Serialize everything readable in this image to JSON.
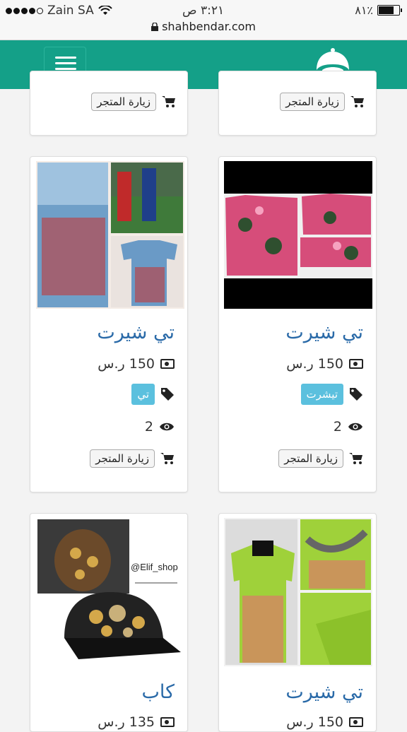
{
  "status_bar": {
    "carrier": "Zain SA",
    "time": "٣:٢١ ص",
    "battery": "٨١٪",
    "battery_level": 0.81,
    "url": "shahbendar.com"
  },
  "colors": {
    "brand": "#14a088",
    "title": "#2a6aa8",
    "badge": "#5bc0de"
  },
  "header": {
    "menu_icon": "hamburger-icon",
    "logo_icon": "turban-logo-icon"
  },
  "cards": [
    {
      "visit_label": "زيارة المتجر"
    },
    {
      "visit_label": "زيارة المتجر"
    },
    {
      "title": "تي شيرت",
      "price": "150 ر.س",
      "tag": "تيشرت",
      "views": "2",
      "visit_label": "زيارة المتجر"
    },
    {
      "title": "تي شيرت",
      "price": "150 ر.س",
      "tag": "تي",
      "views": "2",
      "visit_label": "زيارة المتجر"
    },
    {
      "title": "تي شيرت",
      "price": "150 ر.س"
    },
    {
      "title": "كاب",
      "price": "135 ر.س",
      "watermark": "@Elif_shop"
    }
  ]
}
